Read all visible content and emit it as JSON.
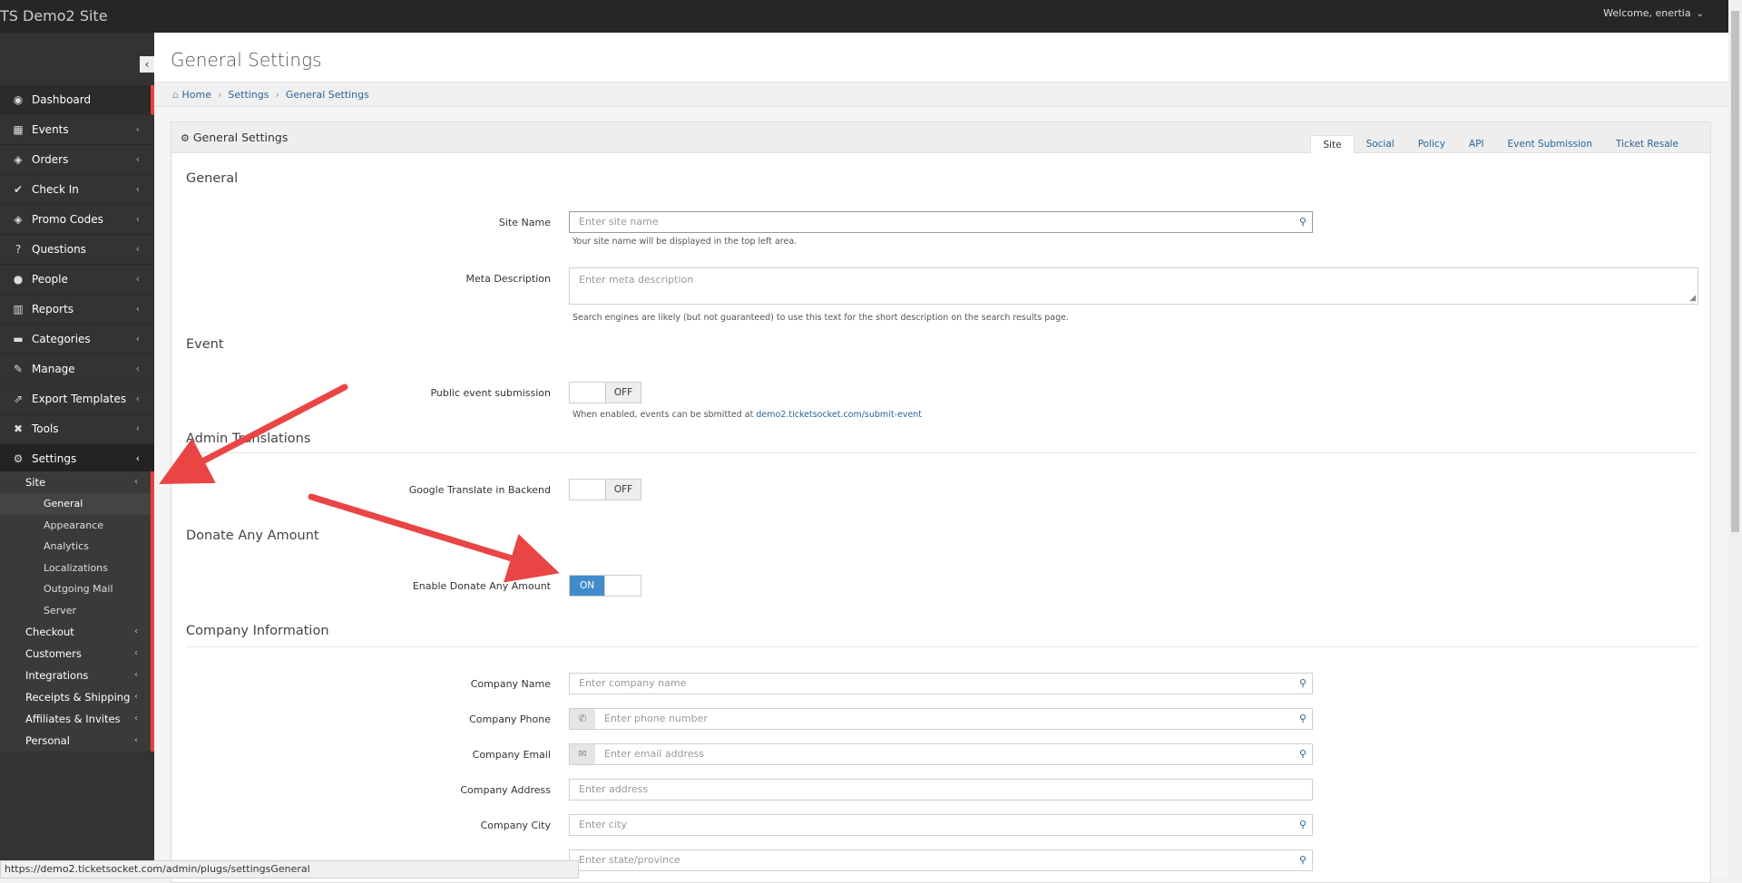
{
  "topbar": {
    "site_title": "TS Demo2 Site",
    "welcome": "Welcome, enertia"
  },
  "sidebar": {
    "items": [
      {
        "icon": "dashboard-icon",
        "glyph": "◉",
        "label": "Dashboard"
      },
      {
        "icon": "calendar-icon",
        "glyph": "▦",
        "label": "Events"
      },
      {
        "icon": "tag-icon",
        "glyph": "◈",
        "label": "Orders"
      },
      {
        "icon": "check-icon",
        "glyph": "✔",
        "label": "Check In"
      },
      {
        "icon": "tags-icon",
        "glyph": "◈",
        "label": "Promo Codes"
      },
      {
        "icon": "question-icon",
        "glyph": "?",
        "label": "Questions"
      },
      {
        "icon": "user-icon",
        "glyph": "●",
        "label": "People"
      },
      {
        "icon": "bar-chart-icon",
        "glyph": "▥",
        "label": "Reports"
      },
      {
        "icon": "folder-icon",
        "glyph": "▬",
        "label": "Categories"
      },
      {
        "icon": "edit-icon",
        "glyph": "✎",
        "label": "Manage"
      },
      {
        "icon": "external-link-icon",
        "glyph": "⇗",
        "label": "Export Templates"
      },
      {
        "icon": "wrench-icon",
        "glyph": "✖",
        "label": "Tools"
      },
      {
        "icon": "cogs-icon",
        "glyph": "⚙",
        "label": "Settings"
      }
    ],
    "submenu": {
      "site_label": "Site",
      "site_children": [
        "General",
        "Appearance",
        "Analytics",
        "Localizations",
        "Outgoing Mail",
        "Server"
      ],
      "groups": [
        "Checkout",
        "Customers",
        "Integrations",
        "Receipts & Shipping",
        "Affiliates & Invites",
        "Personal"
      ]
    }
  },
  "page": {
    "title": "General Settings",
    "breadcrumb": {
      "home": "Home",
      "settings": "Settings",
      "current": "General Settings"
    },
    "panel_title": "General Settings",
    "tabs": [
      "Site",
      "Social",
      "Policy",
      "API",
      "Event Submission",
      "Ticket Resale"
    ]
  },
  "form": {
    "sections": {
      "general": "General",
      "event": "Event",
      "admin_translations": "Admin Translations",
      "donate": "Donate Any Amount",
      "company": "Company Information"
    },
    "site_name": {
      "label": "Site Name",
      "placeholder": "Enter site name",
      "help": "Your site name will be displayed in the top left area."
    },
    "meta_description": {
      "label": "Meta Description",
      "placeholder": "Enter meta description",
      "help": "Search engines are likely (but not guaranteed) to use this text for the short description on the search results page."
    },
    "public_event_submission": {
      "label": "Public event submission",
      "state": "OFF",
      "help_prefix": "When enabled, events can be sbmitted at ",
      "help_link": "demo2.ticketsocket.com/submit-event"
    },
    "google_translate": {
      "label": "Google Translate in Backend",
      "state": "OFF"
    },
    "donate_any_amount": {
      "label": "Enable Donate Any Amount",
      "state": "ON"
    },
    "company_name": {
      "label": "Company Name",
      "placeholder": "Enter company name"
    },
    "company_phone": {
      "label": "Company Phone",
      "placeholder": "Enter phone number"
    },
    "company_email": {
      "label": "Company Email",
      "placeholder": "Enter email address"
    },
    "company_address": {
      "label": "Company Address",
      "placeholder": "Enter address"
    },
    "company_city": {
      "label": "Company City",
      "placeholder": "Enter city"
    },
    "company_state": {
      "placeholder": "Enter state/province"
    }
  },
  "statusbar": {
    "url": "https://demo2.ticketsocket.com/admin/plugs/settingsGeneral"
  },
  "colors": {
    "accent_red": "#e94040",
    "link_blue": "#2a6496",
    "toggle_on": "#428bca",
    "sidebar_bg": "#333333"
  }
}
